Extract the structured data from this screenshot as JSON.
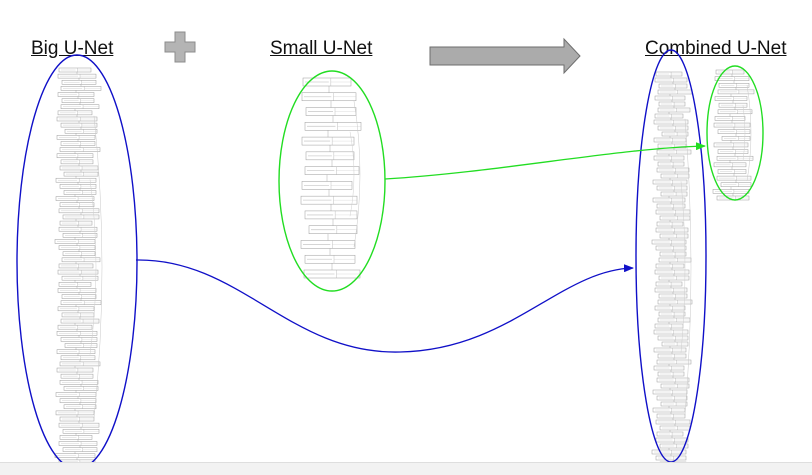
{
  "titles": {
    "big": "Big U-Net",
    "small": "Small U-Net",
    "combined": "Combined U-Net"
  },
  "colors": {
    "big_highlight": "#1010c8",
    "small_highlight": "#22dd22",
    "plus": "#b0b0b0",
    "arrow": "#a8a8a8"
  }
}
